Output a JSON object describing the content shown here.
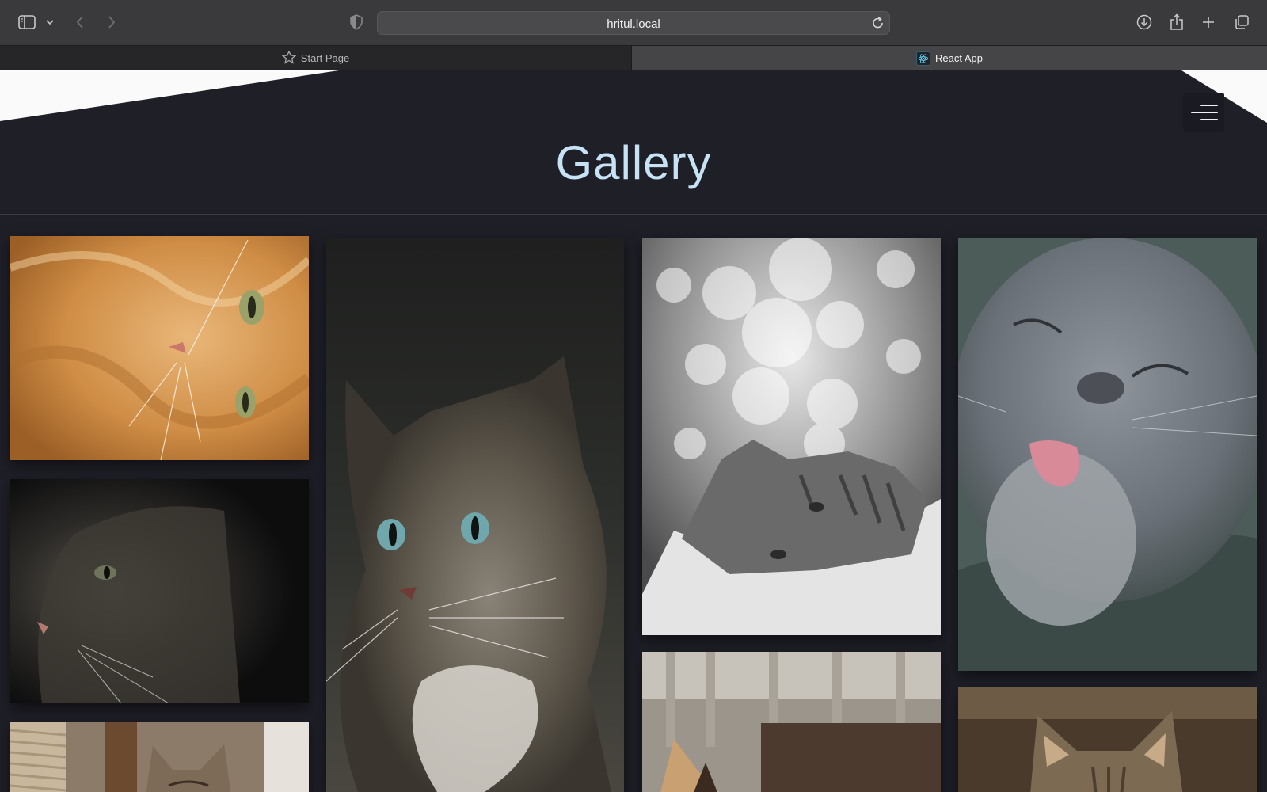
{
  "browser": {
    "address": "hritul.local",
    "tabs": [
      {
        "label": "Start Page",
        "icon": "star-icon",
        "active": false
      },
      {
        "label": "React App",
        "icon": "react-icon",
        "active": true
      }
    ]
  },
  "page": {
    "title": "Gallery",
    "accent_color": "#c6e2f4",
    "background_color": "#1f1f28",
    "photos": [
      {
        "subject": "orange tabby cat lying down",
        "column": 1
      },
      {
        "subject": "dark tabby cat profile",
        "column": 1
      },
      {
        "subject": "tabby kitten by scratching post",
        "column": 1
      },
      {
        "subject": "long-haired tabby cat with blue eyes",
        "column": 2
      },
      {
        "subject": "black and white tabby kitten with bokeh",
        "column": 3
      },
      {
        "subject": "calico cat outdoors",
        "column": 3
      },
      {
        "subject": "grey cat licking nose",
        "column": 4
      },
      {
        "subject": "tabby cat ears close-up",
        "column": 4
      }
    ]
  }
}
